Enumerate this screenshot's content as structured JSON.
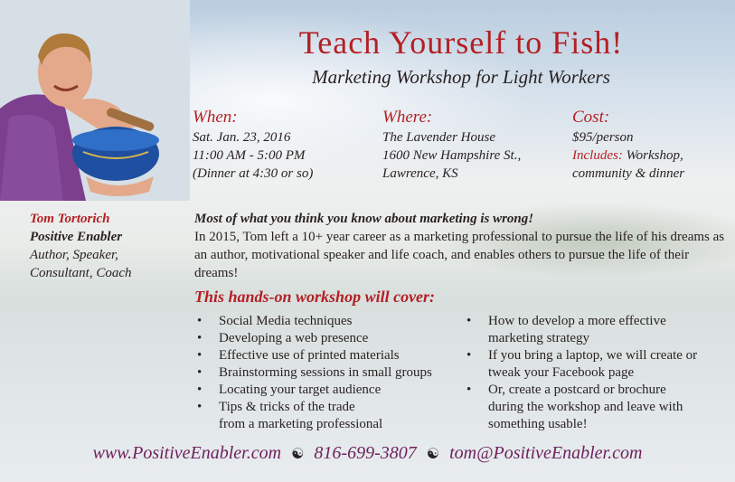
{
  "header": {
    "title": "Teach Yourself to Fish!",
    "subtitle": "Marketing Workshop for Light Workers"
  },
  "when": {
    "heading": "When:",
    "lines": [
      "Sat. Jan. 23, 2016",
      "11:00 AM - 5:00 PM",
      "(Dinner at 4:30 or so)"
    ]
  },
  "where": {
    "heading": "Where:",
    "lines": [
      "The Lavender House",
      "1600 New Hampshire St.,",
      "Lawrence, KS"
    ]
  },
  "cost": {
    "heading": "Cost:",
    "price": "$95/person",
    "includes_label": "Includes:",
    "includes_text": "Workshop,",
    "includes_line2": "community & dinner"
  },
  "presenter": {
    "name": "Tom Tortorich",
    "role": "Positive Enabler",
    "desc1": "Author, Speaker,",
    "desc2": "Consultant, Coach"
  },
  "intro": {
    "lead": "Most of what you think you know about marketing is wrong!",
    "body": "In 2015, Tom left a 10+ year career as a marketing professional to pursue the life of his dreams as an author, motivational speaker and life coach, and enables others to pursue the life of their dreams!"
  },
  "workshop": {
    "heading": "This hands-on workshop will cover:",
    "left_items": [
      {
        "l1": "Social Media techniques",
        "l2": ""
      },
      {
        "l1": "Developing a web presence",
        "l2": ""
      },
      {
        "l1": "Effective use of printed materials",
        "l2": ""
      },
      {
        "l1": "Brainstorming sessions in small groups",
        "l2": ""
      },
      {
        "l1": "Locating your target audience",
        "l2": ""
      },
      {
        "l1": "Tips & tricks of the trade",
        "l2": "from a marketing professional"
      }
    ],
    "right_items": [
      {
        "l1": "How to develop a more effective",
        "l2": "marketing strategy",
        "l3": ""
      },
      {
        "l1": "If you bring a laptop, we will create or",
        "l2": "tweak your Facebook page",
        "l3": ""
      },
      {
        "l1": "Or, create a postcard or brochure",
        "l2": "during the workshop and leave with",
        "l3": "something usable!"
      }
    ]
  },
  "footer": {
    "website": "www.PositiveEnabler.com",
    "phone": "816-699-3807",
    "email": "tom@PositiveEnabler.com",
    "separator": "☯"
  },
  "colors": {
    "accent_red": "#b41f24",
    "footer_purple": "#6e1f5d"
  }
}
